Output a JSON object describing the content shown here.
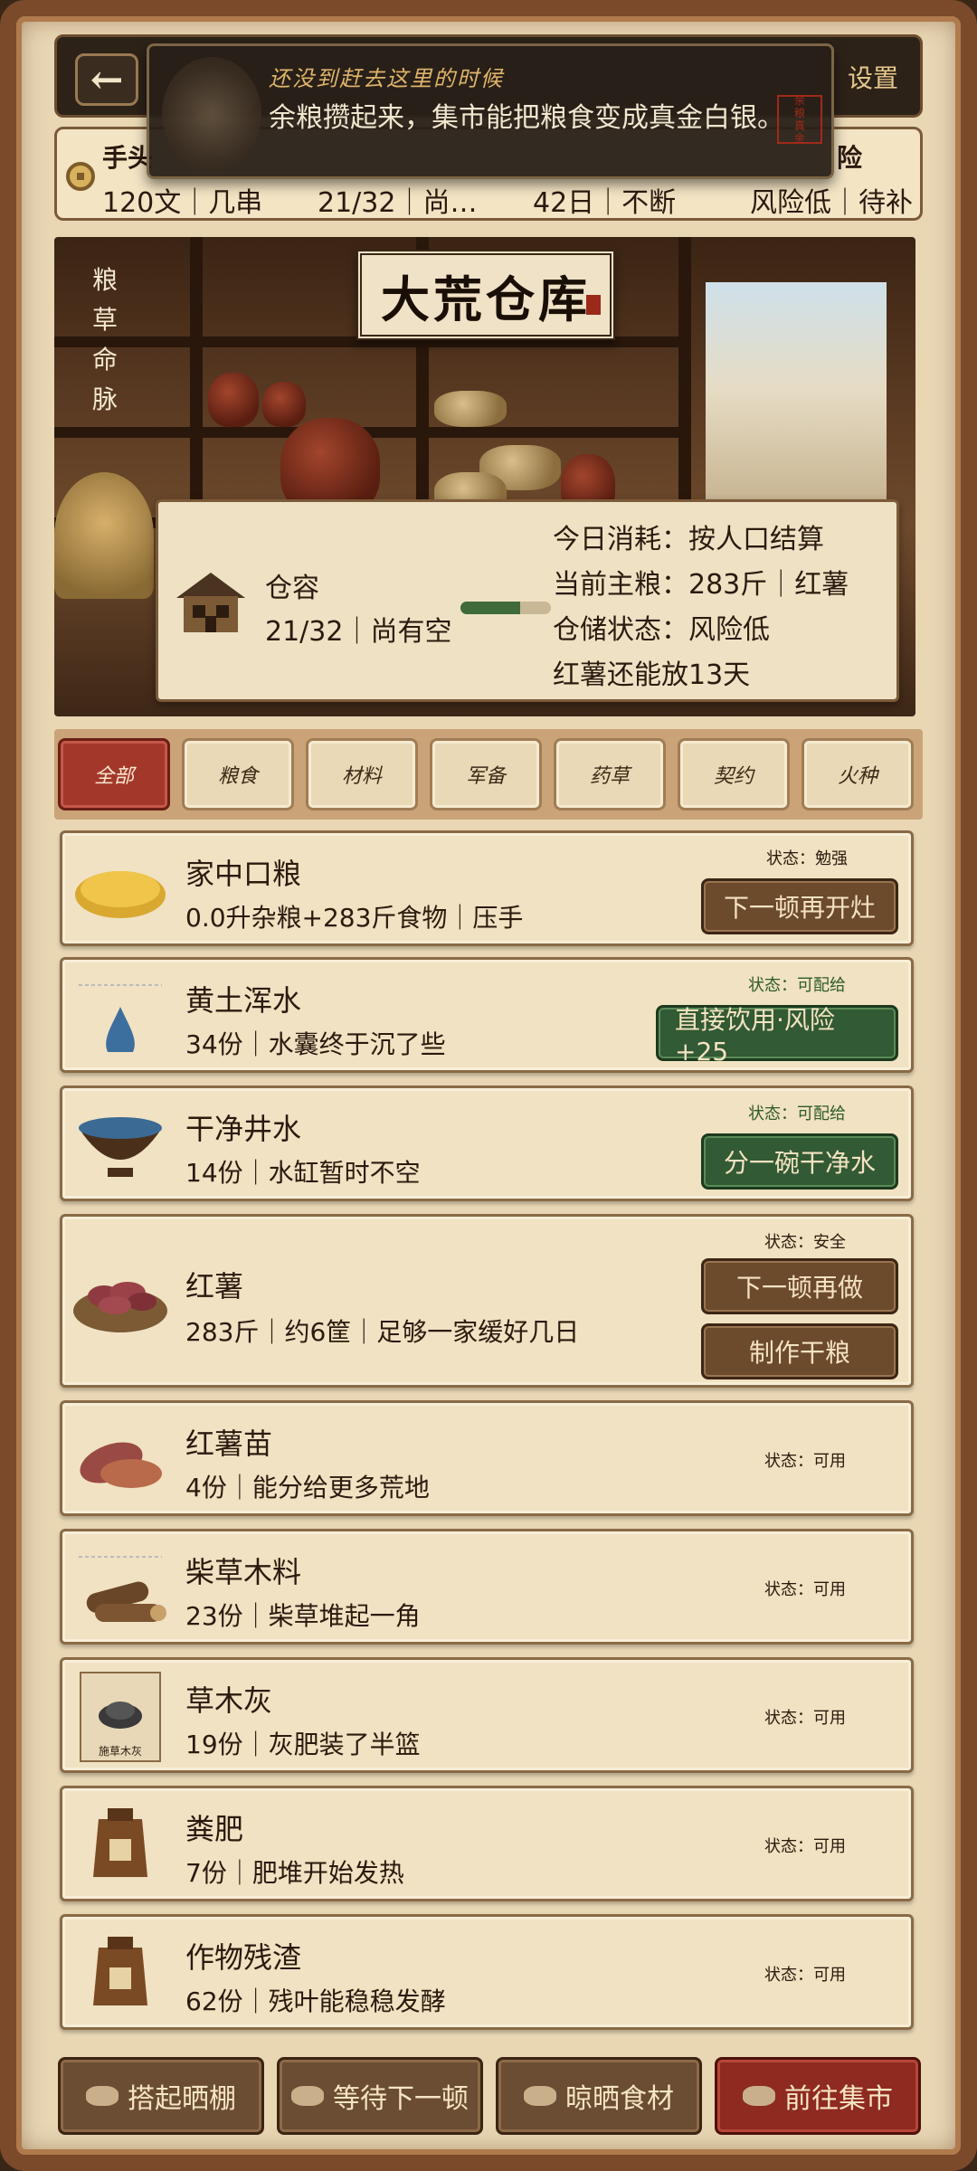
{
  "topbar": {
    "back_icon": "arrow-left",
    "settings_label": "设置"
  },
  "notice": {
    "title": "还没到赶去这里的时候",
    "text": "余粮攒起来，集市能把粮食变成真金白银。",
    "seal_text": "余粮真金"
  },
  "stats": [
    {
      "label": "手头",
      "value": "120文｜几串"
    },
    {
      "label": "",
      "value": "21/32｜尚…"
    },
    {
      "label": "",
      "value": "42日｜不断"
    },
    {
      "label": "险",
      "value": "风险低｜待补"
    }
  ],
  "hero": {
    "vertical_text": [
      "粮",
      "草",
      "命",
      "脉"
    ],
    "title": "大荒仓库"
  },
  "storage": {
    "capacity_label": "仓容",
    "capacity_value": "21/32｜尚有空",
    "capacity_fraction": 0.66,
    "lines": [
      "今日消耗：按人口结算",
      "当前主粮：283斤｜红薯",
      "仓储状态：风险低",
      "红薯还能放13天"
    ]
  },
  "filters": [
    {
      "label": "全部",
      "active": true
    },
    {
      "label": "粮食",
      "active": false
    },
    {
      "label": "材料",
      "active": false
    },
    {
      "label": "军备",
      "active": false
    },
    {
      "label": "药草",
      "active": false
    },
    {
      "label": "契约",
      "active": false
    },
    {
      "label": "火种",
      "active": false
    }
  ],
  "items": [
    {
      "name": "家中口粮",
      "desc": "0.0升杂粮+283斤食物｜压手",
      "status": "状态：勉强",
      "icon": "grain-plate-icon",
      "buttons": [
        "下一顿再开灶"
      ]
    },
    {
      "name": "黄土浑水",
      "desc": "34份｜水囊终于沉了些",
      "status": "状态：可配给",
      "icon": "water-drop-icon",
      "buttons": [
        "直接饮用·风险+25"
      ]
    },
    {
      "name": "干净井水",
      "desc": "14份｜水缸暂时不空",
      "status": "状态：可配给",
      "icon": "water-bowl-icon",
      "buttons": [
        "分一碗干净水"
      ]
    },
    {
      "name": "红薯",
      "desc": "283斤｜约6筐｜足够一家缓好几日",
      "status": "状态：安全",
      "icon": "sweet-potato-basket-icon",
      "buttons": [
        "下一顿再做",
        "制作干粮"
      ]
    },
    {
      "name": "红薯苗",
      "desc": "4份｜能分给更多荒地",
      "status": "状态：可用",
      "icon": "sweet-potato-icon",
      "buttons": []
    },
    {
      "name": "柴草木料",
      "desc": "23份｜柴草堆起一角",
      "status": "状态：可用",
      "icon": "firewood-icon",
      "buttons": []
    },
    {
      "name": "草木灰",
      "desc": "19份｜灰肥装了半篮",
      "status": "状态：可用",
      "icon": "ash-icon",
      "icon_caption": "施草木灰",
      "buttons": []
    },
    {
      "name": "粪肥",
      "desc": "7份｜肥堆开始发热",
      "status": "状态：可用",
      "icon": "fertilizer-sack-icon",
      "buttons": []
    },
    {
      "name": "作物残渣",
      "desc": "62份｜残叶能稳稳发酵",
      "status": "状态：可用",
      "icon": "fertilizer-sack-icon",
      "buttons": []
    }
  ],
  "bottom": [
    {
      "label": "搭起晒棚",
      "icon": "shed-icon"
    },
    {
      "label": "等待下一顿",
      "icon": "bowl-icon"
    },
    {
      "label": "晾晒食材",
      "icon": "rack-icon"
    },
    {
      "label": "前往集市",
      "icon": "market-icon"
    }
  ],
  "colors": {
    "accent_red": "#a3372a",
    "accent_green": "#325a34",
    "button_brown": "#6c4a2c",
    "paper": "#f0e2c2"
  }
}
